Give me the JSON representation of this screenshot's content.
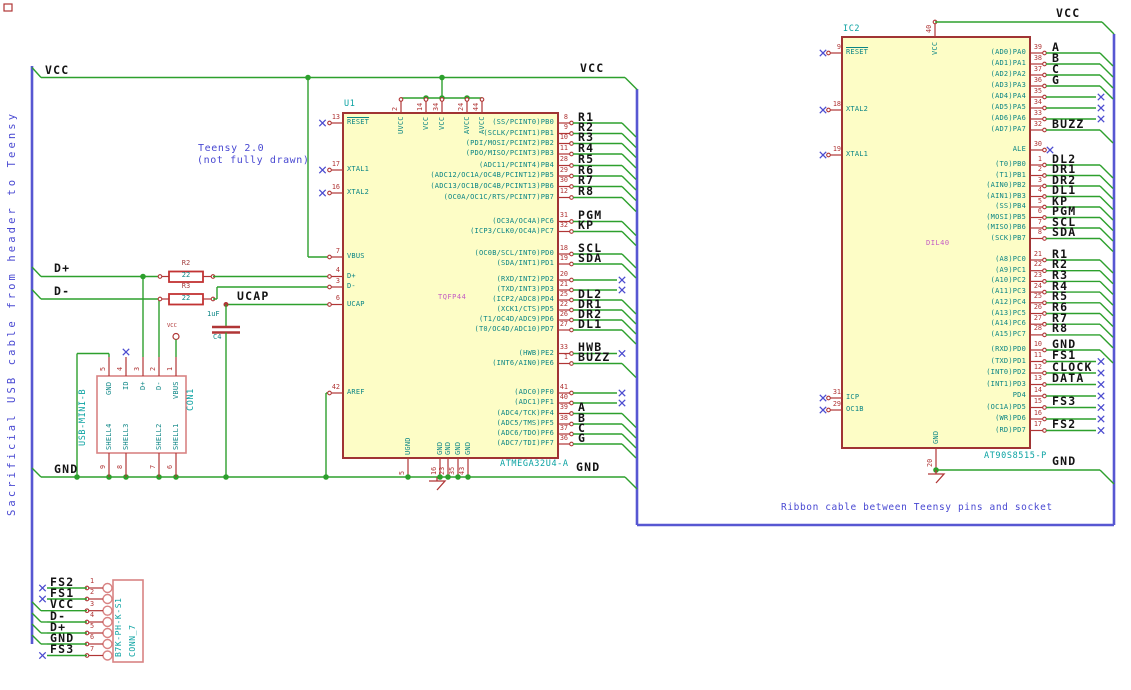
{
  "labels": {
    "vcc": "VCC",
    "gnd": "GND",
    "dplus": "D+",
    "dminus": "D-",
    "ucap": "UCAP"
  },
  "notes": {
    "teensy1": "Teensy 2.0",
    "teensy2": "(not fully drawn)",
    "ribbon": "Ribbon cable between Teensy pins and socket",
    "usb": "Sacrificial USB cable from header to Teensy"
  },
  "u1": {
    "ref": "U1",
    "value": "ATMEGA32U4-A",
    "package": "TQFP44",
    "right_pins": [
      [
        123,
        "8",
        "(SS/PCINT0)PB0",
        "R1",
        "bus"
      ],
      [
        133.5,
        "9",
        "(SCLK/PCINT1)PB1",
        "R2",
        "bus"
      ],
      [
        143.5,
        "10",
        "(PDI/MOSI/PCINT2)PB2",
        "R3",
        "bus"
      ],
      [
        154,
        "11",
        "(PDO/MISO/PCINT3)PB3",
        "R4",
        "bus"
      ],
      [
        165.5,
        "28",
        "(ADC11/PCINT4)PB4",
        "R5",
        "bus"
      ],
      [
        176,
        "29",
        "(ADC12/OC1A/OC4B/PCINT12)PB5",
        "R6",
        "bus"
      ],
      [
        186.5,
        "30",
        "(ADC13/OC1B/OC4B/PCINT13)PB6",
        "R7",
        "bus"
      ],
      [
        197.5,
        "12",
        "(OC0A/OC1C/RTS/PCINT7)PB7",
        "R8",
        "bus"
      ],
      [
        221.5,
        "31",
        "(OC3A/OC4A)PC6",
        "PGM",
        "bus"
      ],
      [
        231.5,
        "32",
        "(ICP3/CLK0/OC4A)PC7",
        "KP",
        "bus"
      ],
      [
        254,
        "18",
        "(OC0B/SCL/INT0)PD0",
        "SCL",
        "bus"
      ],
      [
        264,
        "19",
        "(SDA/INT1)PD1",
        "SDA",
        "bus"
      ],
      [
        280,
        "20",
        "(RXD/INT2)PD2",
        "",
        "nc"
      ],
      [
        290,
        "21",
        "(TXD/INT3)PD3",
        "",
        "nc"
      ],
      [
        300,
        "25",
        "(ICP2/ADC8)PD4",
        "DL2",
        "bus"
      ],
      [
        310,
        "22",
        "(XCK1/CTS)PD5",
        "DR1",
        "bus"
      ],
      [
        320,
        "26",
        "(T1/OC4D/ADC9)PD6",
        "DR2",
        "bus"
      ],
      [
        330,
        "27",
        "(T0/OC4D/ADC10)PD7",
        "DL1",
        "bus"
      ],
      [
        353.5,
        "33",
        "(HWB)PE2",
        "HWB",
        "nc"
      ],
      [
        363.5,
        "1",
        "(INT6/AIN0)PE6",
        "BUZZ",
        "bus"
      ],
      [
        393,
        "41",
        "(ADC0)PF0",
        "",
        "nc"
      ],
      [
        403,
        "40",
        "(ADC1)PF1",
        "",
        "nc"
      ],
      [
        413.5,
        "39",
        "(ADC4/TCK)PF4",
        "A",
        "bus"
      ],
      [
        424,
        "38",
        "(ADC5/TMS)PF5",
        "B",
        "bus"
      ],
      [
        434,
        "37",
        "(ADC6/TDO)PF6",
        "C",
        "bus"
      ],
      [
        444,
        "36",
        "(ADC7/TDI)PF7",
        "G",
        "bus"
      ]
    ],
    "left_pins": [
      [
        123,
        "13",
        "RESET",
        "nc"
      ],
      [
        170,
        "17",
        "XTAL1",
        "nc"
      ],
      [
        193,
        "16",
        "XTAL2",
        "nc"
      ],
      [
        257,
        "7",
        "VBUS",
        "wire"
      ],
      [
        276.5,
        "4",
        "D+",
        "wire"
      ],
      [
        287,
        "3",
        "D-",
        "wire"
      ],
      [
        304.5,
        "6",
        "UCAP",
        "wire"
      ],
      [
        393,
        "42",
        "AREF",
        "wire"
      ]
    ],
    "top_pins": [
      [
        401,
        "2",
        "UVCC"
      ],
      [
        426,
        "14",
        "VCC"
      ],
      [
        442,
        "34",
        "VCC"
      ],
      [
        467,
        "24",
        "AVCC"
      ],
      [
        482,
        "44",
        "AVCC"
      ]
    ],
    "bottom_pins": [
      [
        408,
        "5",
        "UGND"
      ],
      [
        440,
        "16",
        "GND"
      ],
      [
        448,
        "23",
        "GND"
      ],
      [
        458,
        "35",
        "GND"
      ],
      [
        468,
        "43",
        "GND"
      ]
    ]
  },
  "ic2": {
    "ref": "IC2",
    "value": "AT90S8515-P",
    "package": "DIL40",
    "top_pin": {
      "num": "40",
      "name": "VCC"
    },
    "bottom_pin": {
      "num": "20",
      "name": "GND"
    },
    "right_pins": [
      [
        53,
        "39",
        "(AD0)PA0",
        "A",
        "bus"
      ],
      [
        64,
        "38",
        "(AD1)PA1",
        "B",
        "bus"
      ],
      [
        75,
        "37",
        "(AD2)PA2",
        "C",
        "bus"
      ],
      [
        86,
        "36",
        "(AD3)PA3",
        "G",
        "bus"
      ],
      [
        97,
        "35",
        "(AD4)PA4",
        "",
        "nc"
      ],
      [
        108,
        "34",
        "(AD5)PA5",
        "",
        "nc"
      ],
      [
        119,
        "33",
        "(AD6)PA6",
        "",
        "nc"
      ],
      [
        130,
        "32",
        "(AD7)PA7",
        "BUZZ",
        "bus"
      ],
      [
        150,
        "30",
        "ALE",
        "",
        "nc-pin"
      ],
      [
        165,
        "1",
        "(T0)PB0",
        "DL2",
        "bus"
      ],
      [
        175.5,
        "2",
        "(T1)PB1",
        "DR1",
        "bus"
      ],
      [
        186,
        "3",
        "(AIN0)PB2",
        "DR2",
        "bus"
      ],
      [
        196.5,
        "4",
        "(AIN1)PB3",
        "DL1",
        "bus"
      ],
      [
        207,
        "5",
        "(SS)PB4",
        "KP",
        "bus"
      ],
      [
        217.5,
        "6",
        "(MOSI)PB5",
        "PGM",
        "bus"
      ],
      [
        228,
        "7",
        "(MISO)PB6",
        "SCL",
        "bus"
      ],
      [
        238.5,
        "8",
        "(SCK)PB7",
        "SDA",
        "bus"
      ],
      [
        260,
        "21",
        "(A8)PC0",
        "R1",
        "bus"
      ],
      [
        270.7,
        "22",
        "(A9)PC1",
        "R2",
        "bus"
      ],
      [
        281.4,
        "23",
        "(A10)PC2",
        "R3",
        "bus"
      ],
      [
        292.1,
        "24",
        "(A11)PC3",
        "R4",
        "bus"
      ],
      [
        302.8,
        "25",
        "(A12)PC4",
        "R5",
        "bus"
      ],
      [
        313.5,
        "26",
        "(A13)PC5",
        "R6",
        "bus"
      ],
      [
        324.2,
        "27",
        "(A14)PC6",
        "R7",
        "bus"
      ],
      [
        334.9,
        "28",
        "(A15)PC7",
        "R8",
        "bus"
      ],
      [
        350,
        "10",
        "(RXD)PD0",
        "GND",
        "bus"
      ],
      [
        361.5,
        "11",
        "(TXD)PD1",
        "FS1",
        "nc"
      ],
      [
        373,
        "12",
        "(INT0)PD2",
        "CLOCK",
        "nc"
      ],
      [
        384.5,
        "13",
        "(INT1)PD3",
        "DATA",
        "nc"
      ],
      [
        396,
        "14",
        "PD4",
        "",
        "nc"
      ],
      [
        407.5,
        "15",
        "(OC1A)PD5",
        "FS3",
        "nc"
      ],
      [
        419,
        "16",
        "(WR)PD6",
        "",
        "nc"
      ],
      [
        430.5,
        "17",
        "(RD)PD7",
        "FS2",
        "nc"
      ]
    ],
    "left_pins": [
      [
        53,
        "9",
        "RESET",
        "nc"
      ],
      [
        110,
        "18",
        "XTAL2",
        "nc"
      ],
      [
        155,
        "19",
        "XTAL1",
        "nc"
      ],
      [
        398,
        "31",
        "ICP",
        "nc"
      ],
      [
        410,
        "29",
        "OC1B",
        "nc"
      ]
    ]
  },
  "con1": {
    "ref": "CON1",
    "value": "USB-MINI-B",
    "top_pins": [
      [
        109,
        "5",
        "GND"
      ],
      [
        126,
        "4",
        "ID"
      ],
      [
        143,
        "3",
        "D+"
      ],
      [
        159,
        "2",
        "D-"
      ],
      [
        176,
        "1",
        "VBUS"
      ]
    ],
    "bottom_pins": [
      [
        109,
        "9",
        "SHELL4"
      ],
      [
        126,
        "8",
        "SHELL3"
      ],
      [
        159,
        "7",
        "SHELL2"
      ],
      [
        176,
        "6",
        "SHELL1"
      ]
    ]
  },
  "conn7": {
    "ref": "CONN_7",
    "value": "B7K-PH-K-S1",
    "pins": [
      [
        588,
        "1",
        "FS2",
        "nc"
      ],
      [
        599,
        "2",
        "FS1",
        "nc"
      ],
      [
        610.7,
        "3",
        "VCC",
        "bus"
      ],
      [
        622,
        "4",
        "D-",
        "bus"
      ],
      [
        633,
        "5",
        "D+",
        "bus"
      ],
      [
        644,
        "6",
        "GND",
        "bus"
      ],
      [
        655.5,
        "7",
        "FS3",
        "nc"
      ]
    ]
  },
  "r2": {
    "ref": "R2",
    "value": "22"
  },
  "r3": {
    "ref": "R3",
    "value": "22"
  },
  "c4": {
    "ref": "C4",
    "value": "1uF"
  }
}
